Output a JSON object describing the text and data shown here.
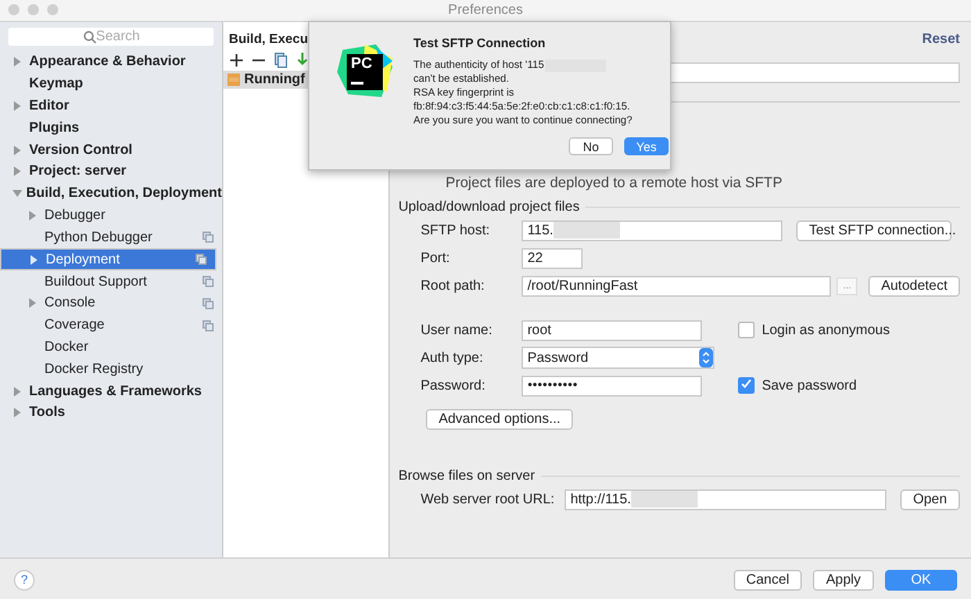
{
  "window": {
    "title": "Preferences"
  },
  "sidebar": {
    "search": {
      "placeholder": "Search"
    },
    "items": [
      {
        "label": "Appearance & Behavior",
        "expanded": false,
        "selected": false
      },
      {
        "label": "Keymap",
        "selected": false
      },
      {
        "label": "Editor",
        "expanded": false,
        "selected": false
      },
      {
        "label": "Plugins",
        "selected": false
      },
      {
        "label": "Version Control",
        "expanded": false,
        "selected": false
      },
      {
        "label": "Project: server",
        "expanded": false,
        "selected": false
      },
      {
        "label": "Build, Execution, Deployment",
        "expanded": true,
        "selected": false,
        "children": [
          {
            "label": "Debugger",
            "expanded": false,
            "selected": false
          },
          {
            "label": "Python Debugger",
            "project_scope": true,
            "selected": false
          },
          {
            "label": "Deployment",
            "expanded": false,
            "project_scope": true,
            "selected": true
          },
          {
            "label": "Buildout Support",
            "project_scope": true,
            "selected": false
          },
          {
            "label": "Console",
            "expanded": false,
            "project_scope": true,
            "selected": false
          },
          {
            "label": "Coverage",
            "project_scope": true,
            "selected": false
          },
          {
            "label": "Docker",
            "selected": false
          },
          {
            "label": "Docker Registry",
            "selected": false
          }
        ]
      },
      {
        "label": "Languages & Frameworks",
        "expanded": false,
        "selected": false
      },
      {
        "label": "Tools",
        "expanded": false,
        "selected": false
      }
    ]
  },
  "breadcrumb": "Build, Execu",
  "reset_link": "Reset",
  "servers": [
    {
      "label": "Runningf",
      "selected": true
    }
  ],
  "description": "Project files are deployed to a remote host via SFTP",
  "upload_section": {
    "title": "Upload/download project files",
    "sftp_host": {
      "label": "SFTP host:",
      "value": "115.",
      "button": "Test SFTP connection..."
    },
    "port": {
      "label": "Port:",
      "value": "22"
    },
    "root_path": {
      "label": "Root path:",
      "value": "/root/RunningFast",
      "browse": "...",
      "button": "Autodetect"
    },
    "user_name": {
      "label": "User name:",
      "value": "root",
      "checkbox": {
        "label": "Login as anonymous",
        "checked": false
      }
    },
    "auth_type": {
      "label": "Auth type:",
      "value": "Password"
    },
    "password": {
      "label": "Password:",
      "value": "●●●●●●●●●●",
      "checkbox": {
        "label": "Save password",
        "checked": true
      }
    },
    "advanced_button": "Advanced options..."
  },
  "browse_section": {
    "title": "Browse files on server",
    "url": {
      "label": "Web server root URL:",
      "value": "http://115.",
      "button": "Open"
    }
  },
  "dialog": {
    "logo_text": "PC",
    "title": "Test SFTP Connection",
    "message_start": "The authenticity of host '115",
    "message_end": "can't be established.",
    "lines": [
      "RSA key fingerprint is",
      "fb:8f:94:c3:f5:44:5a:5e:2f:e0:cb:c1:c8:c1:f0:15.",
      "Are you sure you want to continue connecting?"
    ],
    "buttons": [
      {
        "label": "No",
        "selected": false
      },
      {
        "label": "Yes",
        "selected": true
      }
    ]
  },
  "footer": {
    "help": "?",
    "buttons": [
      {
        "label": "Cancel",
        "selected": false
      },
      {
        "label": "Apply",
        "selected": false
      },
      {
        "label": "OK",
        "selected": true
      }
    ]
  }
}
